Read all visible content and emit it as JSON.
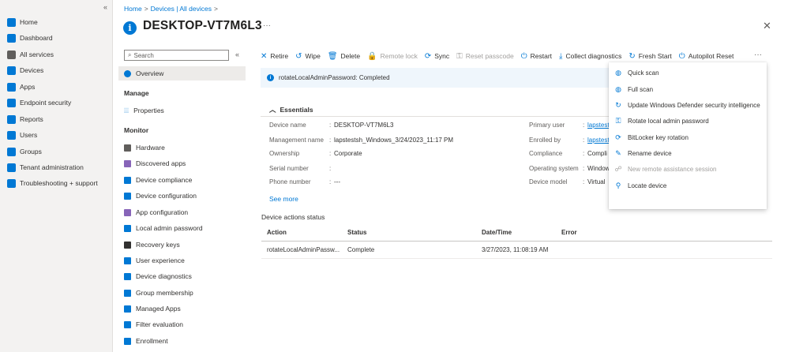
{
  "leftnav": {
    "collapse_glyph": "«",
    "items": [
      {
        "label": "Home",
        "icon": "home-icon",
        "color": "#0078d4"
      },
      {
        "label": "Dashboard",
        "icon": "dashboard-icon",
        "color": "#0078d4"
      },
      {
        "label": "All services",
        "icon": "all-services-icon",
        "color": "#605e5c"
      },
      {
        "label": "Devices",
        "icon": "devices-icon",
        "color": "#0078d4"
      },
      {
        "label": "Apps",
        "icon": "apps-icon",
        "color": "#0078d4"
      },
      {
        "label": "Endpoint security",
        "icon": "endpoint-security-icon",
        "color": "#0078d4"
      },
      {
        "label": "Reports",
        "icon": "reports-icon",
        "color": "#0078d4"
      },
      {
        "label": "Users",
        "icon": "users-icon",
        "color": "#0078d4"
      },
      {
        "label": "Groups",
        "icon": "groups-icon",
        "color": "#0078d4"
      },
      {
        "label": "Tenant administration",
        "icon": "tenant-admin-icon",
        "color": "#0078d4"
      },
      {
        "label": "Troubleshooting + support",
        "icon": "troubleshooting-icon",
        "color": "#0078d4"
      }
    ]
  },
  "breadcrumb": {
    "home": "Home",
    "devices": "Devices | All devices",
    "sep": ">"
  },
  "header": {
    "title": "DESKTOP-VT7M6L3",
    "more": "···",
    "close": "✕"
  },
  "resource_menu": {
    "search_placeholder": "Search",
    "collapse_glyph": "«",
    "overview": "Overview",
    "manage_heading": "Manage",
    "properties": "Properties",
    "monitor_heading": "Monitor",
    "monitor_items": [
      {
        "label": "Hardware",
        "color": "#605e5c"
      },
      {
        "label": "Discovered apps",
        "color": "#8764b8"
      },
      {
        "label": "Device compliance",
        "color": "#0078d4"
      },
      {
        "label": "Device configuration",
        "color": "#0078d4"
      },
      {
        "label": "App configuration",
        "color": "#8764b8"
      },
      {
        "label": "Local admin password",
        "color": "#0078d4"
      },
      {
        "label": "Recovery keys",
        "color": "#323130"
      },
      {
        "label": "User experience",
        "color": "#0078d4"
      },
      {
        "label": "Device diagnostics",
        "color": "#0078d4"
      },
      {
        "label": "Group membership",
        "color": "#0078d4"
      },
      {
        "label": "Managed Apps",
        "color": "#0078d4"
      },
      {
        "label": "Filter evaluation",
        "color": "#0078d4"
      },
      {
        "label": "Enrollment",
        "color": "#0078d4"
      }
    ]
  },
  "toolbar": {
    "actions": [
      {
        "label": "Retire",
        "glyph": "✕",
        "icon": "retire-icon",
        "disabled": false
      },
      {
        "label": "Wipe",
        "glyph": "↺",
        "icon": "wipe-icon",
        "disabled": false
      },
      {
        "label": "Delete",
        "glyph": "🗑",
        "icon": "delete-icon",
        "disabled": false
      },
      {
        "label": "Remote lock",
        "glyph": "🔒",
        "icon": "remote-lock-icon",
        "disabled": true
      },
      {
        "label": "Sync",
        "glyph": "⟳",
        "icon": "sync-icon",
        "disabled": false
      },
      {
        "label": "Reset passcode",
        "glyph": "⚿",
        "icon": "reset-passcode-icon",
        "disabled": true
      },
      {
        "label": "Restart",
        "glyph": "⏻",
        "icon": "restart-icon",
        "disabled": false
      },
      {
        "label": "Collect diagnostics",
        "glyph": "⤓",
        "icon": "collect-diagnostics-icon",
        "disabled": false
      },
      {
        "label": "Fresh Start",
        "glyph": "↻",
        "icon": "fresh-start-icon",
        "disabled": false
      },
      {
        "label": "Autopilot Reset",
        "glyph": "⏻",
        "icon": "autopilot-reset-icon",
        "disabled": false
      }
    ],
    "more": "···"
  },
  "notification": {
    "text": "rotateLocalAdminPassword: Completed"
  },
  "essentials": {
    "heading": "Essentials",
    "left": [
      {
        "label": "Device name",
        "value": "DESKTOP-VT7M6L3"
      },
      {
        "label": "Management name",
        "value": "lapstestsh_Windows_3/24/2023_11:17 PM"
      },
      {
        "label": "Ownership",
        "value": "Corporate"
      },
      {
        "label": "Serial number",
        "value": ""
      },
      {
        "label": "Phone number",
        "value": "---"
      }
    ],
    "right": [
      {
        "label": "Primary user",
        "value": "lapstest",
        "link": true
      },
      {
        "label": "Enrolled by",
        "value": "lapstest",
        "link": true
      },
      {
        "label": "Compliance",
        "value": "Compli",
        "link": false
      },
      {
        "label": "Operating system",
        "value": "Window",
        "link": false
      },
      {
        "label": "Device model",
        "value": "Virtual",
        "link": false
      }
    ],
    "see_more": "See more"
  },
  "actions_status": {
    "title": "Device actions status",
    "columns": [
      "Action",
      "Status",
      "Date/Time",
      "Error"
    ],
    "rows": [
      {
        "action": "rotateLocalAdminPassw...",
        "status": "Complete",
        "datetime": "3/27/2023, 11:08:19 AM",
        "error": ""
      }
    ]
  },
  "more_menu": {
    "items": [
      {
        "label": "Quick scan",
        "glyph": "◍",
        "icon": "quick-scan-icon",
        "disabled": false
      },
      {
        "label": "Full scan",
        "glyph": "◍",
        "icon": "full-scan-icon",
        "disabled": false
      },
      {
        "label": "Update Windows Defender security intelligence",
        "glyph": "↻",
        "icon": "update-defender-icon",
        "disabled": false
      },
      {
        "label": "Rotate local admin password",
        "glyph": "⚿",
        "icon": "rotate-password-icon",
        "disabled": false
      },
      {
        "label": "BitLocker key rotation",
        "glyph": "⟳",
        "icon": "bitlocker-rotation-icon",
        "disabled": false
      },
      {
        "label": "Rename device",
        "glyph": "✎",
        "icon": "rename-icon",
        "disabled": false
      },
      {
        "label": "New remote assistance session",
        "glyph": "☍",
        "icon": "remote-assistance-icon",
        "disabled": true
      },
      {
        "label": "Locate device",
        "glyph": "⚲",
        "icon": "locate-icon",
        "disabled": false
      }
    ]
  }
}
